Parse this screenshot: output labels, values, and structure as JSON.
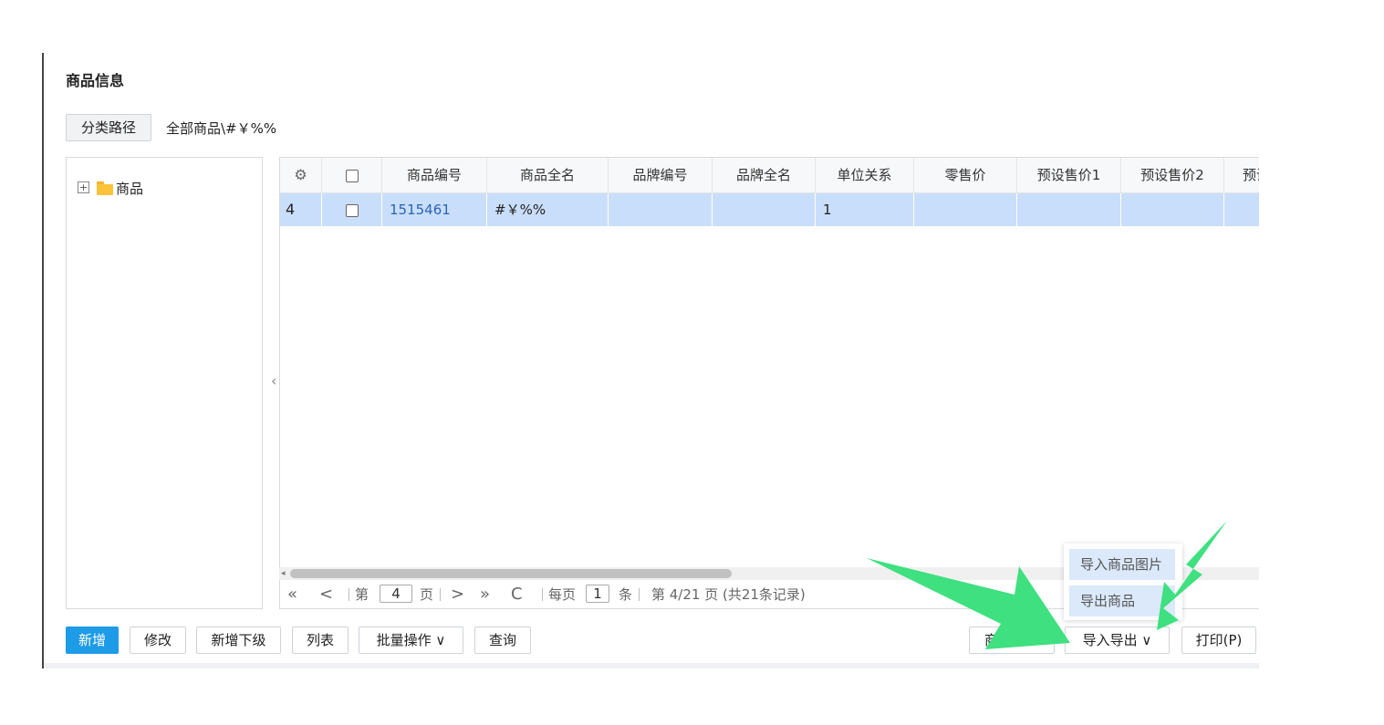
{
  "page": {
    "title": "商品信息"
  },
  "category_path": {
    "button_label": "分类路径",
    "value": "全部商品\\#￥%%"
  },
  "tree": {
    "expand_symbol": "+",
    "root_label": "商品"
  },
  "table": {
    "settings_icon": "gear-icon",
    "columns": [
      "商品编号",
      "商品全名",
      "品牌编号",
      "品牌全名",
      "单位关系",
      "零售价",
      "预设售价1",
      "预设售价2",
      "预设"
    ],
    "rows": [
      {
        "row_number": "4",
        "product_code": "1515461",
        "product_name": "#￥%%",
        "brand_code": "",
        "brand_name": "",
        "unit_relation": "1",
        "retail_price": "",
        "preset_price1": "",
        "preset_price2": "",
        "preset_more": ""
      }
    ]
  },
  "pager": {
    "first": "«",
    "prev": "<",
    "page_prefix": "第",
    "current_page": "4",
    "page_suffix": "页",
    "next": ">",
    "last": "»",
    "refresh": "C",
    "per_page_prefix": "每页",
    "per_page": "1",
    "per_page_suffix": "条",
    "summary": "第 4/21 页 (共21条记录)"
  },
  "toolbar": {
    "add": "新增",
    "edit": "修改",
    "add_child": "新增下级",
    "list": "列表",
    "batch": "批量操作 ∨",
    "query": "查询",
    "sync": "商品同步",
    "import_export": "导入导出 ∨",
    "print": "打印(P)"
  },
  "import_export_menu": {
    "items": [
      "导入商品图片",
      "导出商品"
    ]
  },
  "colors": {
    "primary": "#1e9be6",
    "selected_row": "#c9defa",
    "menu_hover": "#dbe9fb",
    "arrow": "#3ee07f"
  }
}
